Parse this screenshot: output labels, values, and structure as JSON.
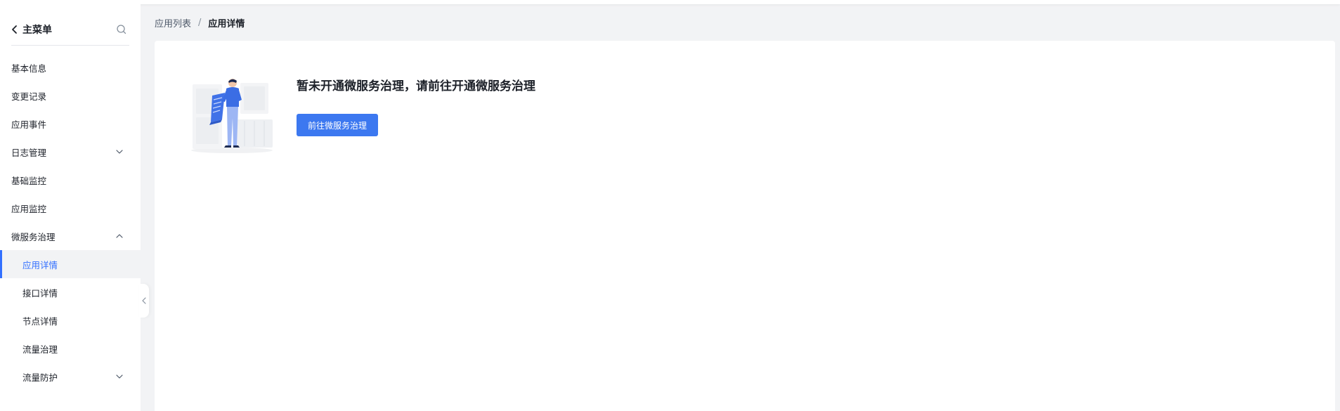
{
  "sidebar": {
    "back_label": "主菜单",
    "items": [
      {
        "label": "基本信息",
        "level": 1,
        "chevron": "none",
        "active": false
      },
      {
        "label": "变更记录",
        "level": 1,
        "chevron": "none",
        "active": false
      },
      {
        "label": "应用事件",
        "level": 1,
        "chevron": "none",
        "active": false
      },
      {
        "label": "日志管理",
        "level": 1,
        "chevron": "down",
        "active": false
      },
      {
        "label": "基础监控",
        "level": 1,
        "chevron": "none",
        "active": false
      },
      {
        "label": "应用监控",
        "level": 1,
        "chevron": "none",
        "active": false
      },
      {
        "label": "微服务治理",
        "level": 1,
        "chevron": "up",
        "active": false
      },
      {
        "label": "应用详情",
        "level": 2,
        "chevron": "none",
        "active": true
      },
      {
        "label": "接口详情",
        "level": 2,
        "chevron": "none",
        "active": false
      },
      {
        "label": "节点详情",
        "level": 2,
        "chevron": "none",
        "active": false
      },
      {
        "label": "流量治理",
        "level": 2,
        "chevron": "none",
        "active": false
      },
      {
        "label": "流量防护",
        "level": 2,
        "chevron": "down",
        "active": false
      }
    ]
  },
  "breadcrumb": {
    "parent": "应用列表",
    "separator": "/",
    "current": "应用详情"
  },
  "main": {
    "notice_title": "暂未开通微服务治理，请前往开通微服务治理",
    "primary_button": "前往微服务治理"
  },
  "colors": {
    "accent": "#3370ff",
    "button": "#3c78f0",
    "page_bg": "#f2f3f5"
  },
  "icons": {
    "back": "chevron-left-icon",
    "search": "search-icon",
    "collapse": "collapse-sidebar-icon",
    "illustration": "empty-state-illustration"
  }
}
